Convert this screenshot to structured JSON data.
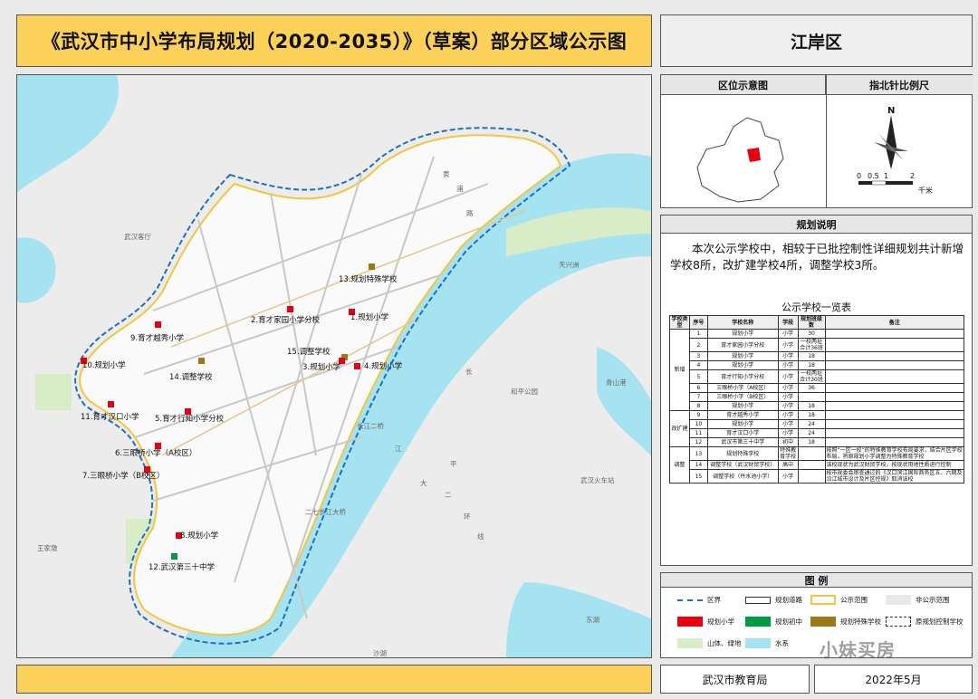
{
  "title": "《武汉市中小学布局规划（2020-2035）》（草案）部分区域公示图",
  "district": "江岸区",
  "location_panel": {
    "left_title": "区位示意图",
    "right_title": "指北针比例尺",
    "north": "N",
    "scale_ticks": [
      "0",
      "0.5",
      "1",
      "2"
    ],
    "scale_unit": "千米"
  },
  "notes": {
    "title": "规划说明",
    "text": "本次公示学校中，相较于已批控制性详细规划共计新增学校8所，改扩建学校4所，调整学校3所。",
    "table_title": "公示学校一览表",
    "headers": [
      "学校类型",
      "序号",
      "学校名称",
      "学段",
      "规划班级数",
      "备注"
    ],
    "groups": [
      {
        "type": "新增",
        "rows": [
          {
            "no": "1",
            "name": "规划小学",
            "level": "小学",
            "classes": "30",
            "note": ""
          },
          {
            "no": "2",
            "name": "育才家园小学分校",
            "level": "小学",
            "classes": "一校两址 合计36班",
            "note": ""
          },
          {
            "no": "3",
            "name": "规划小学",
            "level": "小学",
            "classes": "18",
            "note": ""
          },
          {
            "no": "4",
            "name": "规划小学",
            "level": "小学",
            "classes": "18",
            "note": ""
          },
          {
            "no": "5",
            "name": "育才行知小学分校",
            "level": "小学",
            "classes": "一校两址 合计30班",
            "note": ""
          },
          {
            "no": "6",
            "name": "三眼桥小学（A校区）",
            "level": "小学",
            "classes": "36",
            "note": ""
          },
          {
            "no": "7",
            "name": "三眼桥小学（B校区）",
            "level": "小学",
            "classes": "",
            "note": ""
          },
          {
            "no": "8",
            "name": "规划小学",
            "level": "小学",
            "classes": "18",
            "note": ""
          }
        ]
      },
      {
        "type": "改扩建",
        "rows": [
          {
            "no": "9",
            "name": "育才越秀小学",
            "level": "小学",
            "classes": "18",
            "note": ""
          },
          {
            "no": "10",
            "name": "规划小学",
            "level": "小学",
            "classes": "24",
            "note": ""
          },
          {
            "no": "11",
            "name": "育才汉口小学",
            "level": "小学",
            "classes": "24",
            "note": ""
          },
          {
            "no": "12",
            "name": "武汉市第三十中学",
            "level": "初中",
            "classes": "18",
            "note": ""
          }
        ]
      },
      {
        "type": "调整",
        "rows": [
          {
            "no": "13",
            "name": "规划特殊学校",
            "level": "特殊教育学校",
            "classes": "",
            "note": "按照“一区一校”的特殊教育学校布局要求，结合片区学校布局，将原规划小学调整为特殊教育学校"
          },
          {
            "no": "14",
            "name": "调整学校（武汉财贸学校）",
            "level": "高中",
            "classes": "",
            "note": "该校现状为武汉财贸学校，按现状用地性质进行控制"
          },
          {
            "no": "15",
            "name": "调整学校（丹水池小学）",
            "level": "小学",
            "classes": "",
            "note": "按市规委会审查通过的《汉口滨江国际商务区五、六期及沿江城市设计及片区控规》取消该校"
          }
        ]
      }
    ]
  },
  "legend": {
    "title": "图  例",
    "items": [
      "区界",
      "规划道路",
      "公示范围",
      "非公示范围",
      "规划小学",
      "规划初中",
      "规划特殊学校",
      "原规划控制学校",
      "山体、绿地",
      "水系"
    ],
    "colors": {
      "primary_school": "#e60012",
      "middle_school": "#009a44",
      "special_school": "#9a7a16",
      "greenery": "#d9ecc8",
      "water": "#a6e3f0",
      "public_range": "#f5c542",
      "boundary": "#1f6fbf"
    }
  },
  "footer": {
    "bureau": "武汉市教育局",
    "date": "2022年5月"
  },
  "watermark": "小妹买房",
  "map": {
    "school_labels": [
      "13.规划特殊学校",
      "2.育才家园小学分校",
      "1.规划小学",
      "9.育才越秀小学",
      "15.调整学校",
      "3.规划小学",
      "4.规划小学",
      "10.规划小学",
      "14.调整学校",
      "11.育才汉口小学",
      "5.育才行知小学分校",
      "6.三眼桥小学（A校区）",
      "7.三眼桥小学（B校区）",
      "8.规划小学",
      "12.武汉第三十中学"
    ],
    "place_labels": [
      "武汉客厅",
      "天兴洲",
      "青山港",
      "和平公园",
      "武汉火车站",
      "王家墩",
      "东湖",
      "沙湖",
      "长",
      "江",
      "平",
      "大",
      "二",
      "环",
      "线",
      "长江二桥",
      "二七长江大桥",
      "黄",
      "浦",
      "路"
    ]
  }
}
